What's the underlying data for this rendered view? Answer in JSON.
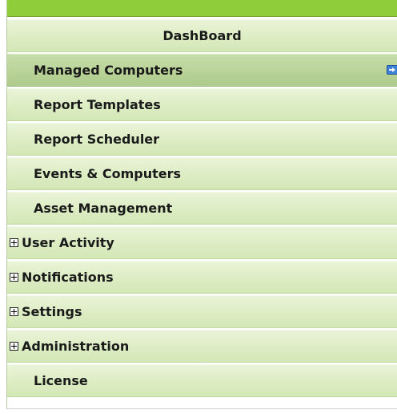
{
  "menu": {
    "items": [
      {
        "label": "DashBoard"
      },
      {
        "label": "Managed Computers"
      },
      {
        "label": "Report Templates"
      },
      {
        "label": "Report Scheduler"
      },
      {
        "label": "Events & Computers"
      },
      {
        "label": "Asset Management"
      },
      {
        "label": "User Activity"
      },
      {
        "label": "Notifications"
      },
      {
        "label": "Settings"
      },
      {
        "label": "Administration"
      },
      {
        "label": "License"
      }
    ]
  },
  "colors": {
    "top_bar": "#8fcd3a",
    "row_bg": "#dcedc3",
    "row_selected_bg": "#b9d398",
    "arrow_icon": "#3d82d6"
  },
  "icons": {
    "expand": "plus-box-icon",
    "go": "arrow-right-icon"
  }
}
